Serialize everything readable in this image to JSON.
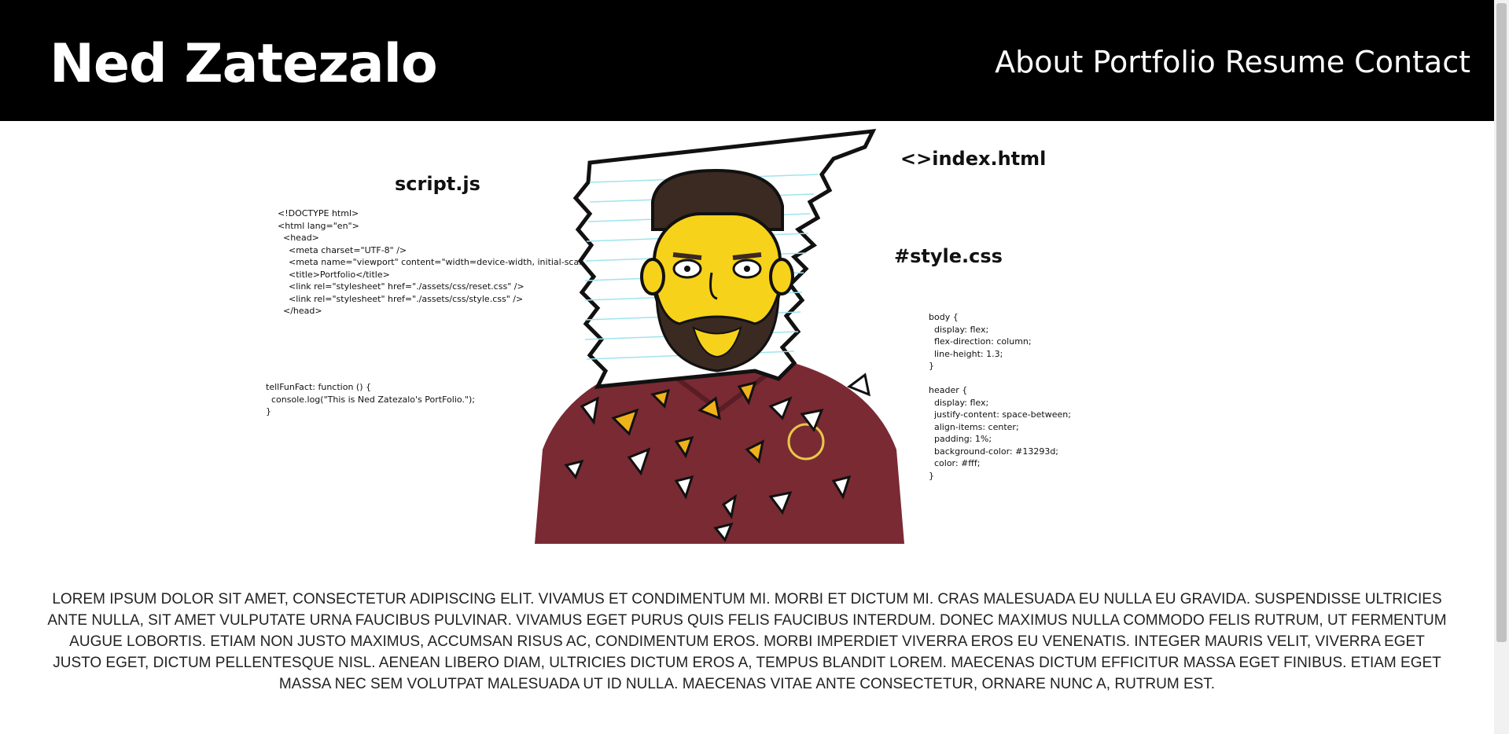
{
  "header": {
    "site_title": "Ned Zatezalo",
    "nav": [
      "About",
      "Portfolio",
      "Resume",
      "Contact"
    ]
  },
  "hero": {
    "script_title": "script.js",
    "html_code": "<!DOCTYPE html>\n<html lang=\"en\">\n  <head>\n    <meta charset=\"UTF-8\" />\n    <meta name=\"viewport\" content=\"width=device-width, initial-scale=1.0\" />\n    <title>Portfolio</title>\n    <link rel=\"stylesheet\" href=\"./assets/css/reset.css\" />\n    <link rel=\"stylesheet\" href=\"./assets/css/style.css\" />\n  </head>",
    "js_code": "tellFunFact: function () {\n  console.log(\"This is Ned Zatezalo's PortFolio.\");\n}",
    "index_title": "<>index.html",
    "style_title": "#style.css",
    "css_code": "body {\n  display: flex;\n  flex-direction: column;\n  line-height: 1.3;\n}\n\nheader {\n  display: flex;\n  justify-content: space-between;\n  align-items: center;\n  padding: 1%;\n  background-color: #13293d;\n  color: #fff;\n}"
  },
  "about_text": "Lorem ipsum dolor sit amet, consectetur adipiscing elit. Vivamus et condimentum mi. Morbi et dictum mi. Cras malesuada eu nulla eu gravida. Suspendisse ultricies ante nulla, sit amet vulputate urna faucibus pulvinar. Vivamus eget purus quis felis faucibus interdum. Donec maximus nulla commodo felis rutrum, ut fermentum augue lobortis. Etiam non justo maximus, accumsan risus ac, condimentum eros. Morbi imperdiet viverra eros eu venenatis. Integer mauris velit, viverra eget justo eget, dictum pellentesque nisl. Aenean libero diam, ultricies dictum eros a, tempus blandit lorem. Maecenas dictum efficitur massa eget finibus. Etiam eget massa nec sem volutpat malesuada ut id nulla. Maecenas vitae ante consectetur, ornare nunc a, rutrum est.",
  "colors": {
    "header_bg": "#000000",
    "shirt": "#7a2a33",
    "skin": "#f7d21a",
    "beard": "#3a2a22",
    "paper_lines": "#9fe3ee"
  }
}
